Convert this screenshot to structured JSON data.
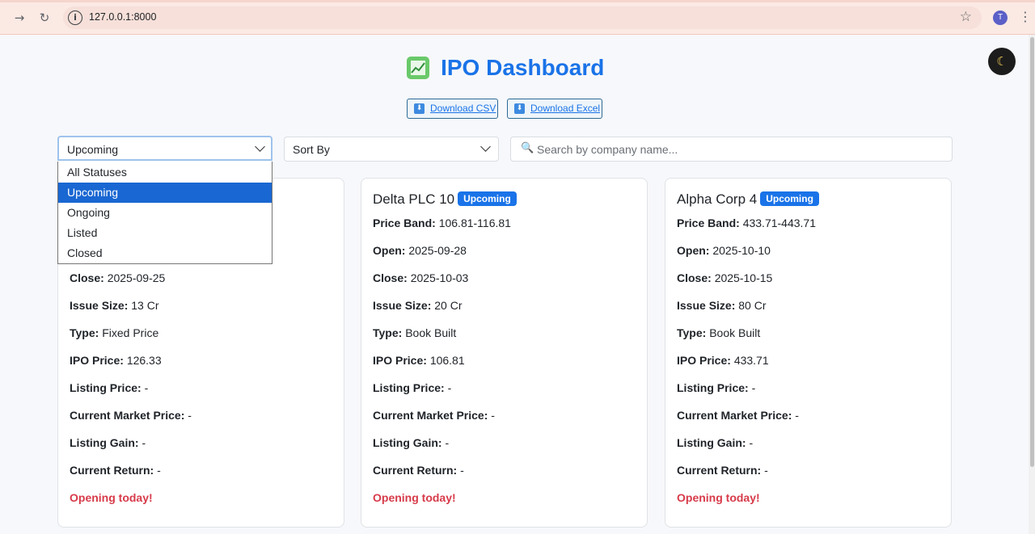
{
  "browser": {
    "url": "127.0.0.1:8000",
    "profile_initial": "T"
  },
  "header": {
    "title": "IPO Dashboard",
    "download_csv": "Download CSV",
    "download_excel": "Download Excel"
  },
  "filters": {
    "status_value": "Upcoming",
    "status_options": [
      "All Statuses",
      "Upcoming",
      "Ongoing",
      "Listed",
      "Closed"
    ],
    "sort_value": "Sort By",
    "search_placeholder": "Search by company name..."
  },
  "labels": {
    "price_band": "Price Band:",
    "open": "Open:",
    "close": "Close:",
    "issue_size": "Issue Size:",
    "type": "Type:",
    "ipo_price": "IPO Price:",
    "listing_price": "Listing Price:",
    "current_market_price": "Current Market Price:",
    "listing_gain": "Listing Gain:",
    "current_return": "Current Return:"
  },
  "cards": [
    {
      "close": "2025-09-25",
      "issue_size": "13 Cr",
      "type": "Fixed Price",
      "ipo_price": "126.33",
      "listing_price": "-",
      "current_market_price": "-",
      "listing_gain": "-",
      "current_return": "-",
      "alert": "Opening today!"
    },
    {
      "name": "Delta PLC 10",
      "status": "Upcoming",
      "price_band": "106.81-116.81",
      "open": "2025-09-28",
      "close": "2025-10-03",
      "issue_size": "20 Cr",
      "type": "Book Built",
      "ipo_price": "106.81",
      "listing_price": "-",
      "current_market_price": "-",
      "listing_gain": "-",
      "current_return": "-",
      "alert": "Opening today!"
    },
    {
      "name": "Alpha Corp 4",
      "status": "Upcoming",
      "price_band": "433.71-443.71",
      "open": "2025-10-10",
      "close": "2025-10-15",
      "issue_size": "80 Cr",
      "type": "Book Built",
      "ipo_price": "433.71",
      "listing_price": "-",
      "current_market_price": "-",
      "listing_gain": "-",
      "current_return": "-",
      "alert": "Opening today!"
    }
  ],
  "colors": {
    "accent": "#1a73e8",
    "alert": "#d73a49",
    "badge": "#1a73e8"
  }
}
